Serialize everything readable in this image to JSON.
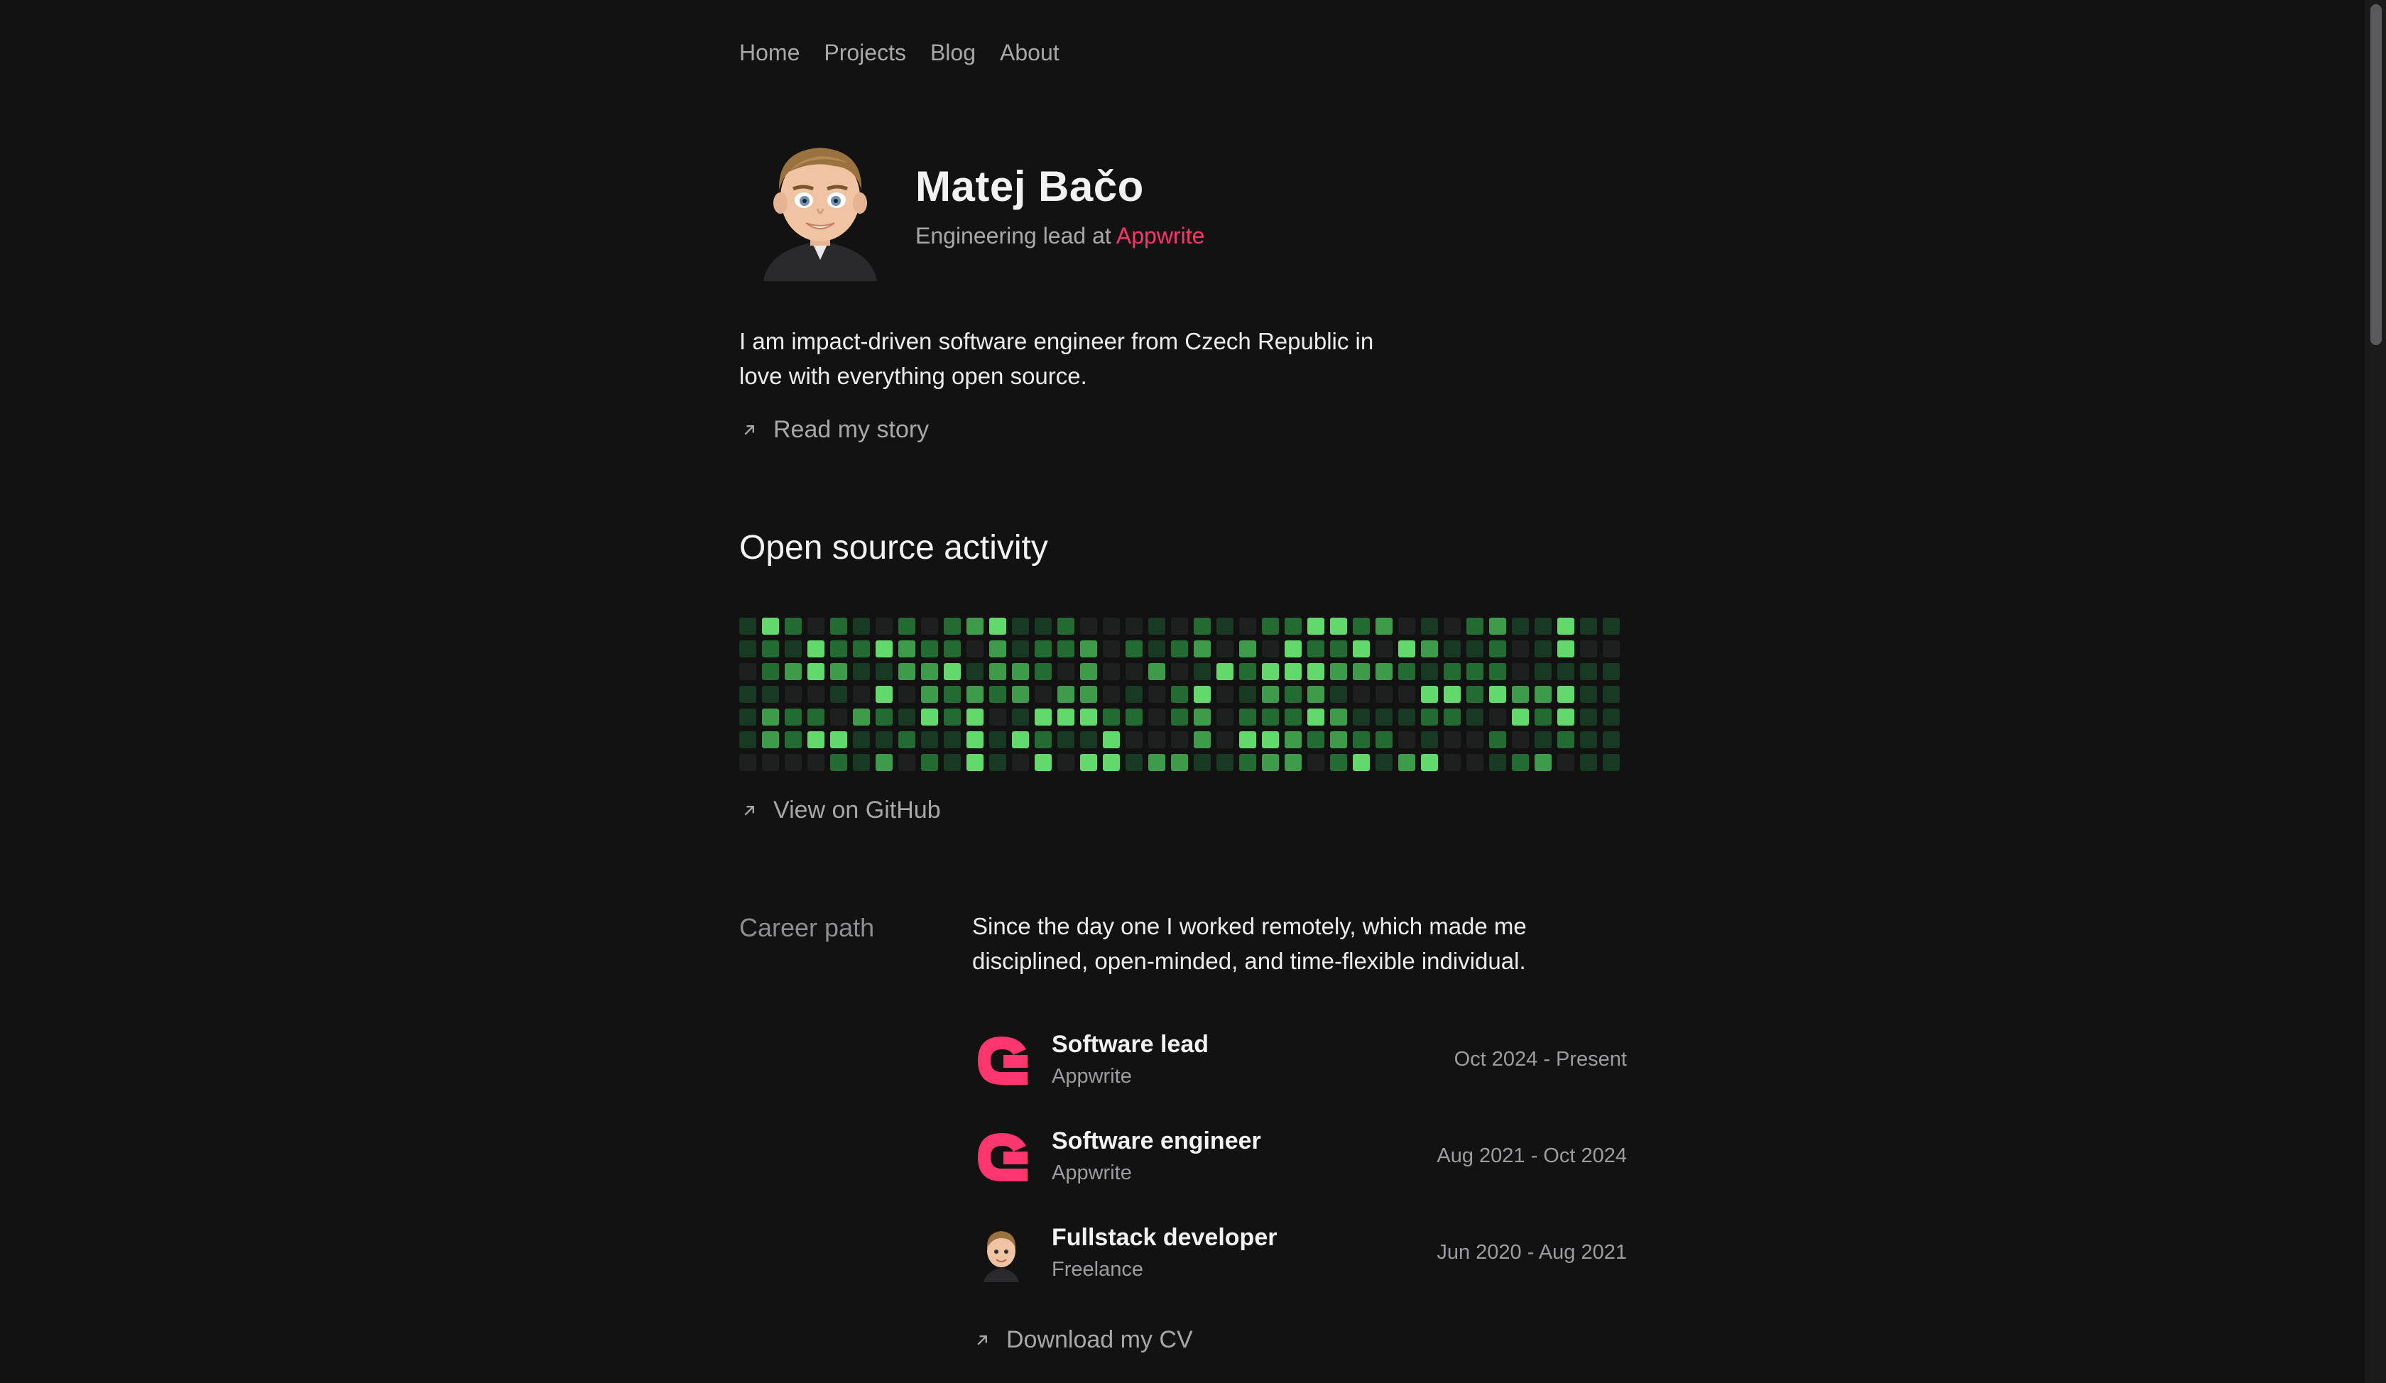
{
  "nav": {
    "items": [
      {
        "label": "Home"
      },
      {
        "label": "Projects"
      },
      {
        "label": "Blog"
      },
      {
        "label": "About"
      }
    ]
  },
  "profile": {
    "name": "Matej Bačo",
    "role_prefix": "Engineering lead at",
    "role_company": "Appwrite",
    "intro": "I am impact-driven software engineer from Czech Republic in love with everything open source.",
    "story_link": "Read my story"
  },
  "activity": {
    "heading": "Open source activity",
    "github_link": "View on GitHub",
    "colors": [
      "#1e1f1f",
      "#193a22",
      "#236b31",
      "#3d9c4a",
      "#62d96b"
    ]
  },
  "career": {
    "label": "Career path",
    "description": "Since the day one I worked remotely, which made me disciplined, open-minded, and time-flexible individual.",
    "jobs": [
      {
        "title": "Software lead",
        "company": "Appwrite",
        "dates": "Oct 2024 - Present",
        "logo": "appwrite-icon"
      },
      {
        "title": "Software engineer",
        "company": "Appwrite",
        "dates": "Aug 2021 - Oct 2024",
        "logo": "appwrite-icon"
      },
      {
        "title": "Fullstack developer",
        "company": "Freelance",
        "dates": "Jun 2020 - Aug 2021",
        "logo": "avatar-icon"
      }
    ],
    "cv_link": "Download my CV"
  },
  "accent": "#fd366e"
}
